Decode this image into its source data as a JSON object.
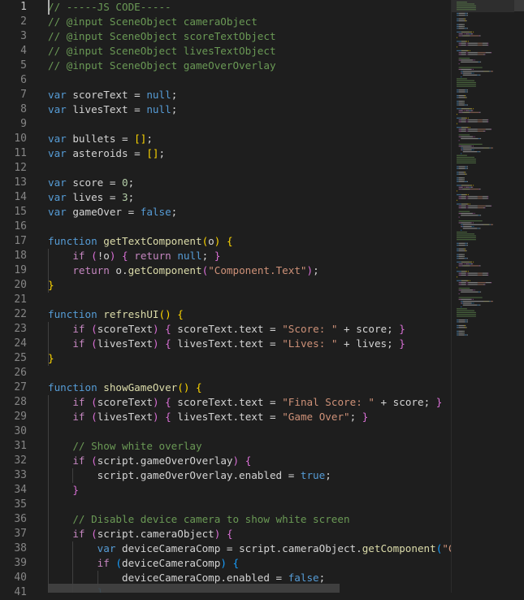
{
  "colors": {
    "background": "#1e1e1e",
    "comment": "#6a9955",
    "keyword": "#569cd6",
    "control_keyword": "#c586c0",
    "function": "#dcdcaa",
    "variable": "#9cdcfe",
    "string": "#ce9178",
    "number": "#b5cea8",
    "plain": "#d4d4d4",
    "bracket_gold": "#ffd700",
    "bracket_purple": "#da70d6",
    "bracket_blue": "#179fff"
  },
  "editor": {
    "active_line": 1,
    "line_numbers": [
      "1",
      "2",
      "3",
      "4",
      "5",
      "6",
      "7",
      "8",
      "9",
      "10",
      "11",
      "12",
      "13",
      "14",
      "15",
      "16",
      "17",
      "18",
      "19",
      "20",
      "21",
      "22",
      "23",
      "24",
      "25",
      "26",
      "27",
      "28",
      "29",
      "30",
      "31",
      "32",
      "33",
      "34",
      "35",
      "36",
      "37",
      "38",
      "39",
      "40",
      "41"
    ],
    "lines": [
      [
        {
          "t": "// -----JS CODE-----",
          "c": "comment"
        }
      ],
      [
        {
          "t": "// @input SceneObject cameraObject",
          "c": "comment"
        }
      ],
      [
        {
          "t": "// @input SceneObject scoreTextObject",
          "c": "comment"
        }
      ],
      [
        {
          "t": "// @input SceneObject livesTextObject",
          "c": "comment"
        }
      ],
      [
        {
          "t": "// @input SceneObject gameOverOverlay",
          "c": "comment"
        }
      ],
      [],
      [
        {
          "t": "var ",
          "c": "keyword"
        },
        {
          "t": "scoreText = ",
          "c": "plain"
        },
        {
          "t": "null",
          "c": "keyword"
        },
        {
          "t": ";",
          "c": "plain"
        }
      ],
      [
        {
          "t": "var ",
          "c": "keyword"
        },
        {
          "t": "livesText = ",
          "c": "plain"
        },
        {
          "t": "null",
          "c": "keyword"
        },
        {
          "t": ";",
          "c": "plain"
        }
      ],
      [],
      [
        {
          "t": "var ",
          "c": "keyword"
        },
        {
          "t": "bullets = ",
          "c": "plain"
        },
        {
          "t": "[]",
          "c": "bracket_gold"
        },
        {
          "t": ";",
          "c": "plain"
        }
      ],
      [
        {
          "t": "var ",
          "c": "keyword"
        },
        {
          "t": "asteroids = ",
          "c": "plain"
        },
        {
          "t": "[]",
          "c": "bracket_gold"
        },
        {
          "t": ";",
          "c": "plain"
        }
      ],
      [],
      [
        {
          "t": "var ",
          "c": "keyword"
        },
        {
          "t": "score = ",
          "c": "plain"
        },
        {
          "t": "0",
          "c": "number"
        },
        {
          "t": ";",
          "c": "plain"
        }
      ],
      [
        {
          "t": "var ",
          "c": "keyword"
        },
        {
          "t": "lives = ",
          "c": "plain"
        },
        {
          "t": "3",
          "c": "number"
        },
        {
          "t": ";",
          "c": "plain"
        }
      ],
      [
        {
          "t": "var ",
          "c": "keyword"
        },
        {
          "t": "gameOver = ",
          "c": "plain"
        },
        {
          "t": "false",
          "c": "keyword"
        },
        {
          "t": ";",
          "c": "plain"
        }
      ],
      [],
      [
        {
          "t": "function ",
          "c": "keyword"
        },
        {
          "t": "getTextComponent",
          "c": "function"
        },
        {
          "t": "(",
          "c": "bracket_gold"
        },
        {
          "t": "o",
          "c": "plain"
        },
        {
          "t": ")",
          "c": "bracket_gold"
        },
        {
          "t": " ",
          "c": "plain"
        },
        {
          "t": "{",
          "c": "bracket_gold"
        }
      ],
      [
        {
          "t": "    ",
          "c": "plain"
        },
        {
          "t": "if ",
          "c": "control_keyword"
        },
        {
          "t": "(",
          "c": "bracket_purple"
        },
        {
          "t": "!o",
          "c": "plain"
        },
        {
          "t": ")",
          "c": "bracket_purple"
        },
        {
          "t": " ",
          "c": "plain"
        },
        {
          "t": "{",
          "c": "bracket_purple"
        },
        {
          "t": " ",
          "c": "plain"
        },
        {
          "t": "return ",
          "c": "control_keyword"
        },
        {
          "t": "null",
          "c": "keyword"
        },
        {
          "t": "; ",
          "c": "plain"
        },
        {
          "t": "}",
          "c": "bracket_purple"
        }
      ],
      [
        {
          "t": "    ",
          "c": "plain"
        },
        {
          "t": "return ",
          "c": "control_keyword"
        },
        {
          "t": "o.",
          "c": "plain"
        },
        {
          "t": "getComponent",
          "c": "function"
        },
        {
          "t": "(",
          "c": "bracket_purple"
        },
        {
          "t": "\"Component.Text\"",
          "c": "string"
        },
        {
          "t": ")",
          "c": "bracket_purple"
        },
        {
          "t": ";",
          "c": "plain"
        }
      ],
      [
        {
          "t": "}",
          "c": "bracket_gold"
        }
      ],
      [],
      [
        {
          "t": "function ",
          "c": "keyword"
        },
        {
          "t": "refreshUI",
          "c": "function"
        },
        {
          "t": "()",
          "c": "bracket_gold"
        },
        {
          "t": " ",
          "c": "plain"
        },
        {
          "t": "{",
          "c": "bracket_gold"
        }
      ],
      [
        {
          "t": "    ",
          "c": "plain"
        },
        {
          "t": "if ",
          "c": "control_keyword"
        },
        {
          "t": "(",
          "c": "bracket_purple"
        },
        {
          "t": "scoreText",
          "c": "plain"
        },
        {
          "t": ")",
          "c": "bracket_purple"
        },
        {
          "t": " ",
          "c": "plain"
        },
        {
          "t": "{",
          "c": "bracket_purple"
        },
        {
          "t": " scoreText.text = ",
          "c": "plain"
        },
        {
          "t": "\"Score: \"",
          "c": "string"
        },
        {
          "t": " + score; ",
          "c": "plain"
        },
        {
          "t": "}",
          "c": "bracket_purple"
        }
      ],
      [
        {
          "t": "    ",
          "c": "plain"
        },
        {
          "t": "if ",
          "c": "control_keyword"
        },
        {
          "t": "(",
          "c": "bracket_purple"
        },
        {
          "t": "livesText",
          "c": "plain"
        },
        {
          "t": ")",
          "c": "bracket_purple"
        },
        {
          "t": " ",
          "c": "plain"
        },
        {
          "t": "{",
          "c": "bracket_purple"
        },
        {
          "t": " livesText.text = ",
          "c": "plain"
        },
        {
          "t": "\"Lives: \"",
          "c": "string"
        },
        {
          "t": " + lives; ",
          "c": "plain"
        },
        {
          "t": "}",
          "c": "bracket_purple"
        }
      ],
      [
        {
          "t": "}",
          "c": "bracket_gold"
        }
      ],
      [],
      [
        {
          "t": "function ",
          "c": "keyword"
        },
        {
          "t": "showGameOver",
          "c": "function"
        },
        {
          "t": "()",
          "c": "bracket_gold"
        },
        {
          "t": " ",
          "c": "plain"
        },
        {
          "t": "{",
          "c": "bracket_gold"
        }
      ],
      [
        {
          "t": "    ",
          "c": "plain"
        },
        {
          "t": "if ",
          "c": "control_keyword"
        },
        {
          "t": "(",
          "c": "bracket_purple"
        },
        {
          "t": "scoreText",
          "c": "plain"
        },
        {
          "t": ")",
          "c": "bracket_purple"
        },
        {
          "t": " ",
          "c": "plain"
        },
        {
          "t": "{",
          "c": "bracket_purple"
        },
        {
          "t": " scoreText.text = ",
          "c": "plain"
        },
        {
          "t": "\"Final Score: \"",
          "c": "string"
        },
        {
          "t": " + score; ",
          "c": "plain"
        },
        {
          "t": "}",
          "c": "bracket_purple"
        }
      ],
      [
        {
          "t": "    ",
          "c": "plain"
        },
        {
          "t": "if ",
          "c": "control_keyword"
        },
        {
          "t": "(",
          "c": "bracket_purple"
        },
        {
          "t": "livesText",
          "c": "plain"
        },
        {
          "t": ")",
          "c": "bracket_purple"
        },
        {
          "t": " ",
          "c": "plain"
        },
        {
          "t": "{",
          "c": "bracket_purple"
        },
        {
          "t": " livesText.text = ",
          "c": "plain"
        },
        {
          "t": "\"Game Over\"",
          "c": "string"
        },
        {
          "t": "; ",
          "c": "plain"
        },
        {
          "t": "}",
          "c": "bracket_purple"
        }
      ],
      [],
      [
        {
          "t": "    ",
          "c": "plain"
        },
        {
          "t": "// Show white overlay",
          "c": "comment"
        }
      ],
      [
        {
          "t": "    ",
          "c": "plain"
        },
        {
          "t": "if ",
          "c": "control_keyword"
        },
        {
          "t": "(",
          "c": "bracket_purple"
        },
        {
          "t": "script.gameOverOverlay",
          "c": "plain"
        },
        {
          "t": ")",
          "c": "bracket_purple"
        },
        {
          "t": " ",
          "c": "plain"
        },
        {
          "t": "{",
          "c": "bracket_purple"
        }
      ],
      [
        {
          "t": "        ",
          "c": "plain"
        },
        {
          "t": "script.gameOverOverlay.enabled = ",
          "c": "plain"
        },
        {
          "t": "true",
          "c": "keyword"
        },
        {
          "t": ";",
          "c": "plain"
        }
      ],
      [
        {
          "t": "    ",
          "c": "plain"
        },
        {
          "t": "}",
          "c": "bracket_purple"
        }
      ],
      [],
      [
        {
          "t": "    ",
          "c": "plain"
        },
        {
          "t": "// Disable device camera to show white screen",
          "c": "comment"
        }
      ],
      [
        {
          "t": "    ",
          "c": "plain"
        },
        {
          "t": "if ",
          "c": "control_keyword"
        },
        {
          "t": "(",
          "c": "bracket_purple"
        },
        {
          "t": "script.cameraObject",
          "c": "plain"
        },
        {
          "t": ")",
          "c": "bracket_purple"
        },
        {
          "t": " ",
          "c": "plain"
        },
        {
          "t": "{",
          "c": "bracket_purple"
        }
      ],
      [
        {
          "t": "        ",
          "c": "plain"
        },
        {
          "t": "var ",
          "c": "keyword"
        },
        {
          "t": "deviceCameraComp = script.cameraObject.",
          "c": "plain"
        },
        {
          "t": "getComponent",
          "c": "function"
        },
        {
          "t": "(",
          "c": "bracket_blue"
        },
        {
          "t": "\"Comp",
          "c": "string"
        }
      ],
      [
        {
          "t": "        ",
          "c": "plain"
        },
        {
          "t": "if ",
          "c": "control_keyword"
        },
        {
          "t": "(",
          "c": "bracket_blue"
        },
        {
          "t": "deviceCameraComp",
          "c": "plain"
        },
        {
          "t": ")",
          "c": "bracket_blue"
        },
        {
          "t": " ",
          "c": "plain"
        },
        {
          "t": "{",
          "c": "bracket_blue"
        }
      ],
      [
        {
          "t": "            ",
          "c": "plain"
        },
        {
          "t": "deviceCameraComp.enabled = ",
          "c": "plain"
        },
        {
          "t": "false",
          "c": "keyword"
        },
        {
          "t": ";",
          "c": "plain"
        }
      ],
      [
        {
          "t": "        ",
          "c": "plain"
        },
        {
          "t": "}",
          "c": "bracket_blue"
        }
      ]
    ]
  }
}
